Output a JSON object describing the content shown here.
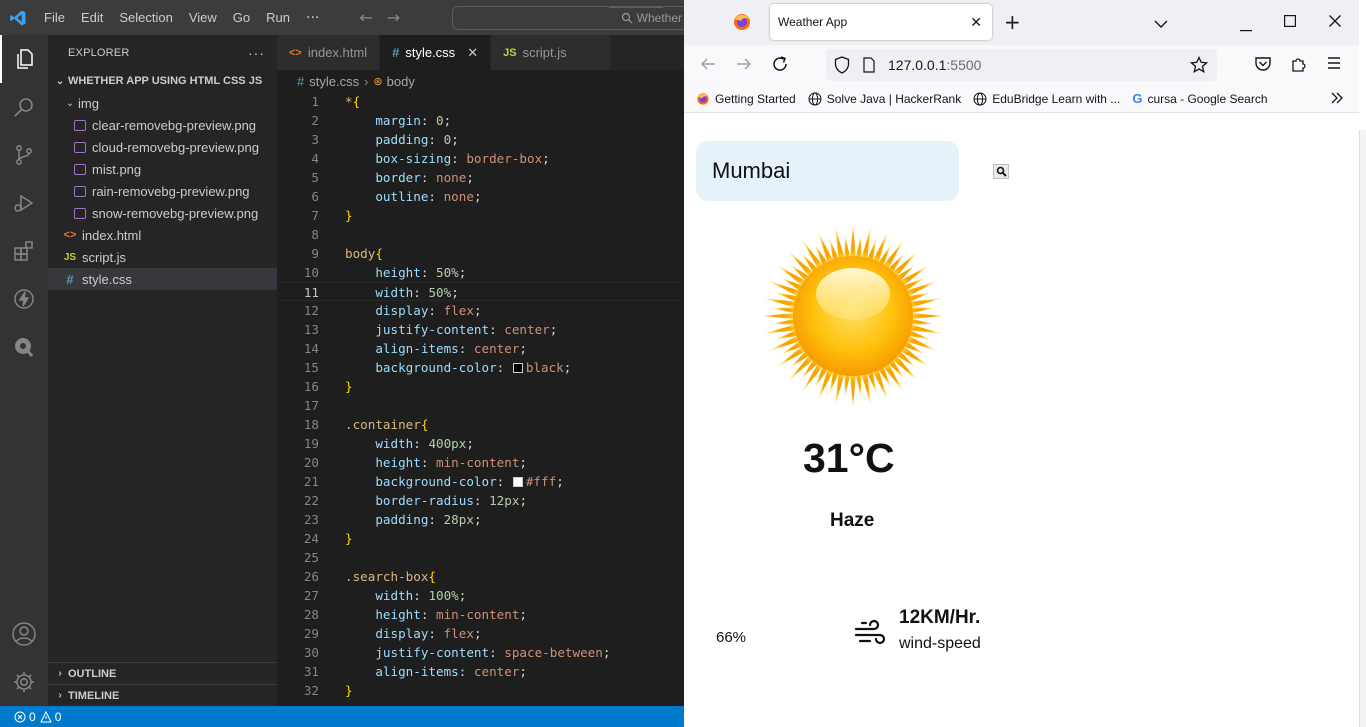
{
  "vscode": {
    "menu": [
      "File",
      "Edit",
      "Selection",
      "View",
      "Go",
      "Run"
    ],
    "menu_more": "···",
    "command_center": "Whether",
    "explorer_title": "EXPLORER",
    "explorer_more": "···",
    "project": "WHETHER APP USING HTML CSS JS",
    "folder": "img",
    "images": [
      "clear-removebg-preview.png",
      "cloud-removebg-preview.png",
      "mist.png",
      "rain-removebg-preview.png",
      "snow-removebg-preview.png"
    ],
    "files": {
      "html": "index.html",
      "js": "script.js",
      "css": "style.css"
    },
    "outline": "OUTLINE",
    "timeline": "TIMELINE",
    "tabs": [
      {
        "icon": "<>",
        "label": "index.html"
      },
      {
        "icon": "#",
        "label": "style.css"
      },
      {
        "icon": "JS",
        "label": "script.js"
      }
    ],
    "breadcrumb": {
      "file": "style.css",
      "symbol": "body"
    },
    "status": {
      "errors": "0",
      "warnings": "0"
    },
    "colors": {
      "accent": "#007acc",
      "selector": "#d7ba7d",
      "property": "#9cdcfe",
      "value": "#ce9178",
      "number": "#b5cea8"
    }
  },
  "code": {
    "line_numbers": [
      "1",
      "2",
      "3",
      "4",
      "5",
      "6",
      "7",
      "8",
      "9",
      "10",
      "11",
      "12",
      "13",
      "14",
      "15",
      "16",
      "17",
      "18",
      "19",
      "20",
      "21",
      "22",
      "23",
      "24",
      "25",
      "26",
      "27",
      "28",
      "29",
      "30",
      "31",
      "32"
    ],
    "l1_sel": "*",
    "l1_brace": "{",
    "l2_prop": "margin",
    "l2_val": "0",
    "l3_prop": "padding",
    "l3_val": "0",
    "l4_prop": "box-sizing",
    "l4_val": "border-box",
    "l5_prop": "border",
    "l5_val": "none",
    "l6_prop": "outline",
    "l6_val": "none",
    "l7_brace": "}",
    "l9_sel": "body",
    "l9_brace": "{",
    "l10_prop": "height",
    "l10_val": "50%",
    "l11_prop": "width",
    "l11_val": "50%",
    "l12_prop": "display",
    "l12_val": "flex",
    "l13_prop": "justify-content",
    "l13_val": "center",
    "l14_prop": "align-items",
    "l14_val": "center",
    "l15_prop": "background-color",
    "l15_val": "black",
    "l16_brace": "}",
    "l18_sel": ".container",
    "l18_brace": "{",
    "l19_prop": "width",
    "l19_val": "400px",
    "l20_prop": "height",
    "l20_val": "min-content",
    "l21_prop": "background-color",
    "l21_val": "#fff",
    "l22_prop": "border-radius",
    "l22_val": "12px",
    "l23_prop": "padding",
    "l23_val": "28px",
    "l24_brace": "}",
    "l26_sel": ".search-box",
    "l26_brace": "{",
    "l27_prop": "width",
    "l27_val": "100%",
    "l28_prop": "height",
    "l28_val": "min-content",
    "l29_prop": "display",
    "l29_val": "flex",
    "l30_prop": "justify-content",
    "l30_val": "space-between",
    "l31_prop": "align-items",
    "l31_val": "center",
    "l32_brace": "}"
  },
  "firefox": {
    "tab_title": "Weather App",
    "tab_close": "✕",
    "new_tab": "+",
    "url_host": "127.0.0.1",
    "url_port": ":5500",
    "bookmarks": [
      "Getting Started",
      "Solve Java | HackerRank",
      "EduBridge Learn with ...",
      "cursa - Google Search"
    ]
  },
  "weather": {
    "city": "Mumbai",
    "temperature": "31°C",
    "condition": "Haze",
    "humidity": "66%",
    "wind_speed": "12KM/Hr.",
    "wind_label": "wind-speed",
    "search_icon": "magnifier-icon"
  }
}
